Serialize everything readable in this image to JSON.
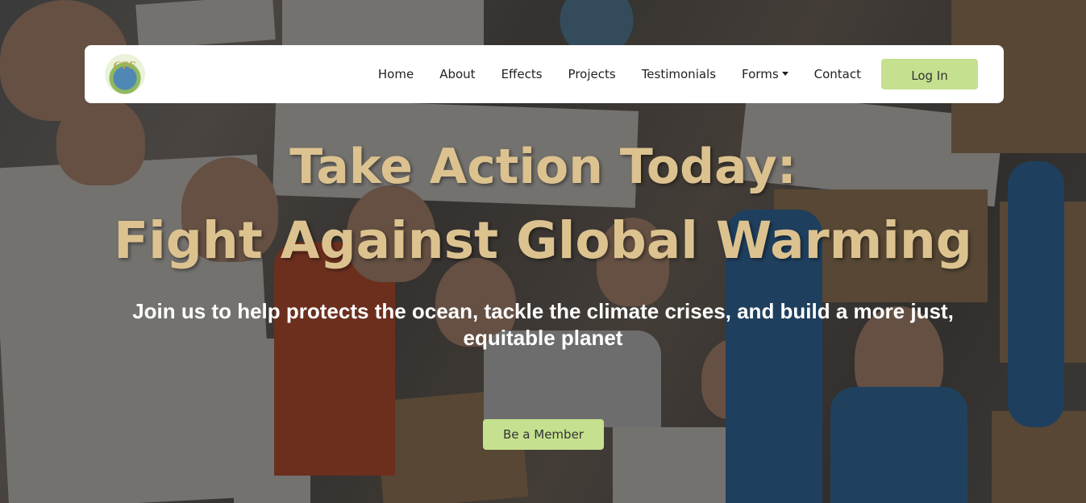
{
  "brand": {
    "logo_text": "CTF"
  },
  "nav": {
    "items": [
      "Home",
      "About",
      "Effects",
      "Projects",
      "Testimonials",
      "Forms",
      "Contact"
    ],
    "login_label": "Log In"
  },
  "hero": {
    "title_line1": "Take Action Today:",
    "title_line2": "Fight Against Global Warming",
    "subtitle": "Join us to help protects the ocean, tackle the climate crises, and build a more just, equitable planet",
    "cta_label": "Be a Member"
  },
  "colors": {
    "accent": "#c5e08f",
    "title_gold": "#dcc28f",
    "navbar_bg": "#ffffff"
  }
}
